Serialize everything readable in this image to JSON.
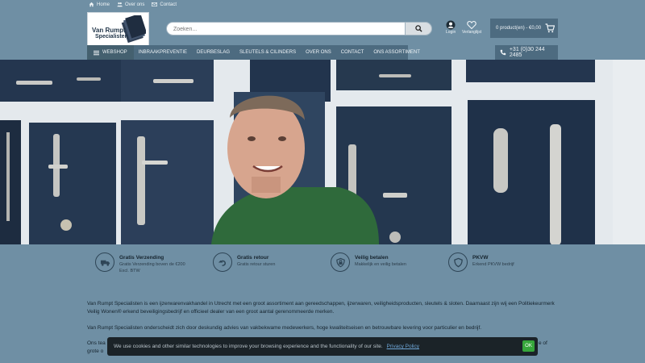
{
  "toplinks": {
    "home": "Home",
    "about": "Over ons",
    "contact": "Contact"
  },
  "logo": {
    "line1": "Van Rumpt",
    "line2": "Specialisten"
  },
  "search": {
    "placeholder": "Zoeken..."
  },
  "header_icons": {
    "login": "Login",
    "wishlist": "Verlanglijst"
  },
  "cart": {
    "label": "0 product(en) - €0,00"
  },
  "nav": {
    "webshop": "WEBSHOP",
    "items": [
      "INBRAAKPREVENTIE",
      "DEURBESLAG",
      "SLEUTELS & CILINDERS",
      "OVER ONS",
      "CONTACT",
      "ONS ASSORTIMENT"
    ]
  },
  "phone": "+31 (0)30 244 2485",
  "usps": [
    {
      "title": "Gratis Verzending",
      "sub": "Gratis Verzending boven de €200 Excl. BTW",
      "icon": "truck-icon"
    },
    {
      "title": "Gratis retour",
      "sub": "Gratis retour sturen",
      "icon": "return-arrow-icon"
    },
    {
      "title": "Veilig betalen",
      "sub": "Makkelijk en veilig betalen",
      "icon": "secure-payment-icon"
    },
    {
      "title": "PKVW",
      "sub": "Erkend PKVW bedrijf",
      "icon": "shield-icon"
    }
  ],
  "content": {
    "p1": "Van Rumpt Specialisten is een ijzerwarenvakhandel in Utrecht met een groot assortiment aan gereedschappen, ijzerwaren, veiligheidsproducten, sleutels & sloten. Daarnaast zijn wij een Politiekeurmerk Veilig Wonen® erkend beveiligingsbedrijf en officieel dealer van een groot aantal gerenommeerde merken.",
    "p2": "Van Rumpt Specialisten onderscheidt zich door deskundig advies van vakbekwame medewerkers, hoge kwaliteitseisen en betrouwbare levering voor particulier en bedrijf.",
    "p3_start": "Ons tea",
    "p3_end": "e of",
    "p4_start": "grote o"
  },
  "cookie": {
    "message": "We use cookies and other similar technologies to improve your browsing experience and the functionality of our site.",
    "link": "Privacy Policy",
    "ok": "OK"
  },
  "colors": {
    "brand": "#6f8fa4",
    "nav": "#4d6b80",
    "ok_button": "#36a63b"
  }
}
